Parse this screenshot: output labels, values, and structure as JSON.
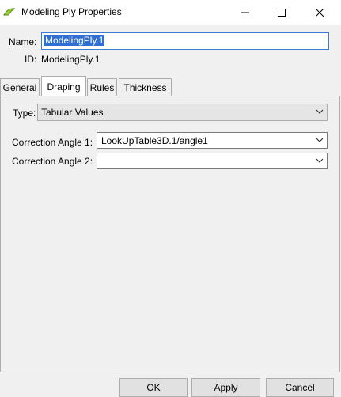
{
  "window": {
    "title": "Modeling Ply Properties"
  },
  "fields": {
    "name_label": "Name:",
    "name_value": "ModelingPly.1",
    "id_label": "ID:",
    "id_value": "ModelingPly.1"
  },
  "tabs": [
    {
      "label": "General"
    },
    {
      "label": "Draping",
      "active": true
    },
    {
      "label": "Rules"
    },
    {
      "label": "Thickness"
    }
  ],
  "draping": {
    "type_label": "Type:",
    "type_value": "Tabular Values",
    "correction_angle_1_label": "Correction Angle 1:",
    "correction_angle_1_value": "LookUpTable3D.1/angle1",
    "correction_angle_2_label": "Correction Angle 2:",
    "correction_angle_2_value": ""
  },
  "buttons": {
    "ok": "OK",
    "apply": "Apply",
    "cancel": "Cancel"
  },
  "colors": {
    "selection": "#2f6fd1",
    "focus_border": "#3a7fcf",
    "window_bg": "#f0f0f0"
  }
}
